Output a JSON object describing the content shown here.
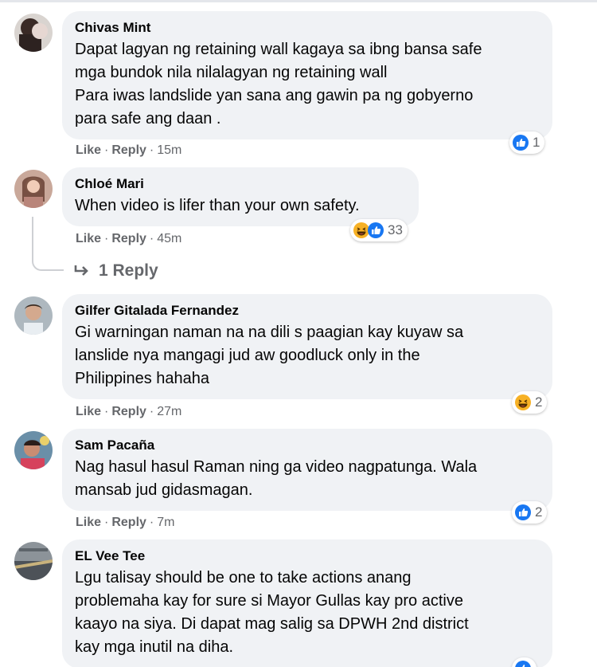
{
  "comments": [
    {
      "author": "Chivas Mint",
      "text": "Dapat lagyan ng retaining wall kagaya sa ibng bansa safe\nmga bundok nila nilalagyan ng retaining wall\nPara iwas landslide yan sana ang gawin pa ng gobyerno\npara safe ang daan .",
      "like": "Like",
      "reply": "Reply",
      "time": "15m",
      "reaction_count": "1",
      "reaction_icons": [
        "like-icon"
      ]
    },
    {
      "author": "Chloé Mari",
      "text": "When video is lifer than your own safety.",
      "like": "Like",
      "reply": "Reply",
      "time": "45m",
      "reaction_count": "33",
      "reaction_icons": [
        "haha-icon",
        "like-icon"
      ],
      "replies_label": "1 Reply"
    },
    {
      "author": "Gilfer Gitalada Fernandez",
      "text": "Gi warningan naman na na dili s paagian kay kuyaw sa\nlanslide nya mangagi jud aw goodluck only in the\nPhilippines hahaha",
      "like": "Like",
      "reply": "Reply",
      "time": "27m",
      "reaction_count": "2",
      "reaction_icons": [
        "haha-icon"
      ]
    },
    {
      "author": "Sam Pacaña",
      "text": "Nag hasul hasul Raman ning ga video nagpatunga. Wala\nmansab jud gidasmagan.",
      "like": "Like",
      "reply": "Reply",
      "time": "7m",
      "reaction_count": "2",
      "reaction_icons": [
        "like-icon"
      ]
    },
    {
      "author": "EL Vee Tee",
      "text": "Lgu talisay should be one to take actions anang\nproblemaha kay for sure si Mayor Gullas kay pro active\nkaayo na siya. Di dapat mag salig sa DPWH 2nd district\nkay mga inutil na diha.",
      "reaction_icons": [
        "like-icon"
      ]
    }
  ],
  "colors": {
    "bubble": "#f0f2f5",
    "meta": "#65676b",
    "like_blue": "#1877f2",
    "haha_yellow": "#f7b125"
  }
}
